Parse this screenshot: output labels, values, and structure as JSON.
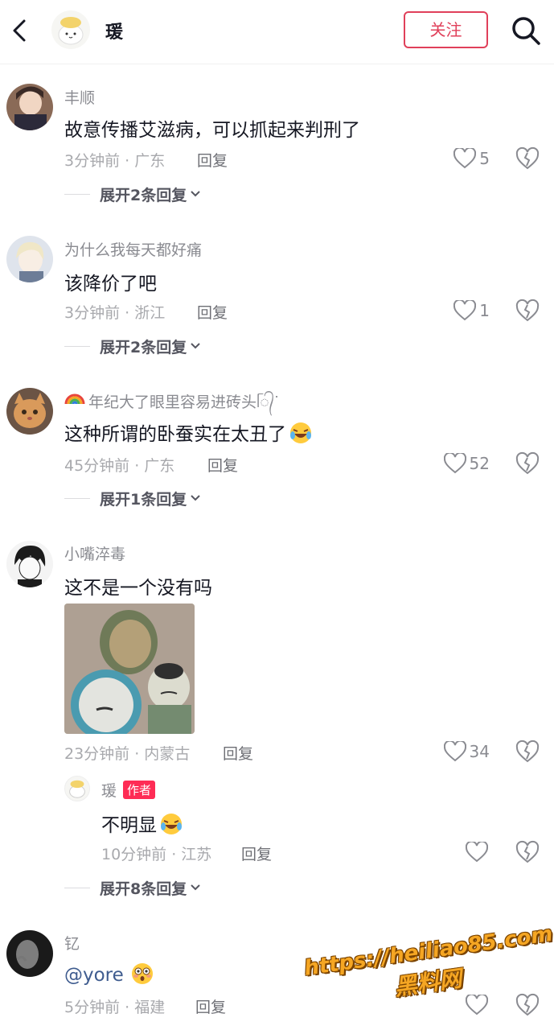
{
  "header": {
    "name": "瑗",
    "follow_label": "关注",
    "icons": [
      "back-icon",
      "search-icon"
    ]
  },
  "comments": [
    {
      "username": "丰顺",
      "text": "故意传播艾滋病，可以抓起来判刑了",
      "time_location": "3分钟前 · 广东",
      "reply_label": "回复",
      "likes": "5",
      "expand_label": "展开2条回复"
    },
    {
      "username": "为什么我每天都好痛",
      "text": "该降价了吧",
      "time_location": "3分钟前 · 浙江",
      "reply_label": "回复",
      "likes": "1",
      "expand_label": "展开2条回复"
    },
    {
      "username": "年纪大了眼里容易进砖头ᥬ᭄ᐝ",
      "text": "这种所谓的卧蚕实在太丑了",
      "time_location": "45分钟前 · 广东",
      "reply_label": "回复",
      "likes": "52",
      "expand_label": "展开1条回复"
    },
    {
      "username": "小嘴淬毒",
      "text": "这不是一个没有吗",
      "time_location": "23分钟前 · 内蒙古",
      "reply_label": "回复",
      "likes": "34",
      "sub_reply": {
        "username": "瑗",
        "badge": "作者",
        "text": "不明显",
        "time_location": "10分钟前 · 江苏",
        "reply_label": "回复"
      },
      "expand_label": "展开8条回复"
    },
    {
      "username": "钇",
      "text": "@yore",
      "time_location": "5分钟前 · 福建",
      "reply_label": "回复"
    }
  ],
  "watermark": {
    "line1": "https://heiliao85.com",
    "line2": "黑料网"
  }
}
